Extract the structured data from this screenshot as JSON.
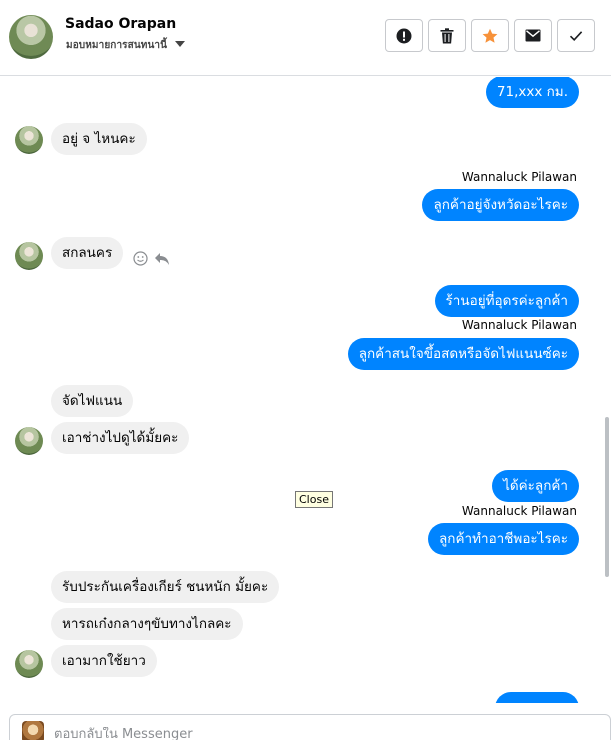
{
  "header": {
    "contact_name": "Sadao Orapan",
    "contact_status": "มอบหมายการสนทนานี้",
    "buttons": {
      "important_icon": "exclamation-circle-icon",
      "delete_icon": "trash-icon",
      "star_icon": "star-icon",
      "email_icon": "envelope-icon",
      "done_icon": "checkmark-icon"
    }
  },
  "messages": [
    {
      "direction": "out",
      "text": "71,xxx กม."
    },
    {
      "direction": "in",
      "text": "อยู่ จ ไหนคะ"
    },
    {
      "sender": "Wannaluck Pilawan"
    },
    {
      "direction": "out",
      "text": "ลูกค้าอยู่จังหวัดอะไรคะ"
    },
    {
      "direction": "in",
      "text": "สกลนคร"
    },
    {
      "direction": "out",
      "text": "ร้านอยู่ที่อุดรค่ะลูกค้า"
    },
    {
      "sender": "Wannaluck Pilawan"
    },
    {
      "direction": "out",
      "text": "ลูกค้าสนใจขึ้อสดหรือจัดไฟแนนซ์คะ"
    },
    {
      "direction": "in",
      "text": "จัดไฟแนน"
    },
    {
      "direction": "in",
      "text": "เอาช่างไปดูได้มั้ยคะ"
    },
    {
      "direction": "out",
      "text": "ได้ค่ะลูกค้า"
    },
    {
      "sender": "Wannaluck Pilawan"
    },
    {
      "direction": "out",
      "text": "ลูกค้าทำอาชีพอะไรคะ"
    },
    {
      "direction": "in",
      "text": "รับประกันเครื่องเกียร์ ชนหนัก มั้ยคะ"
    },
    {
      "direction": "in",
      "text": "หารถเก๋งกลางๆขับทางไกลคะ"
    },
    {
      "direction": "in",
      "text": "เอามากใช้ยาว"
    }
  ],
  "tooltip": {
    "text": "Close"
  },
  "composer": {
    "placeholder": "ตอบกลับใน Messenger"
  },
  "colors": {
    "outgoing": "#0084ff",
    "incoming": "#f0f0f0",
    "star": "#f7923a"
  }
}
